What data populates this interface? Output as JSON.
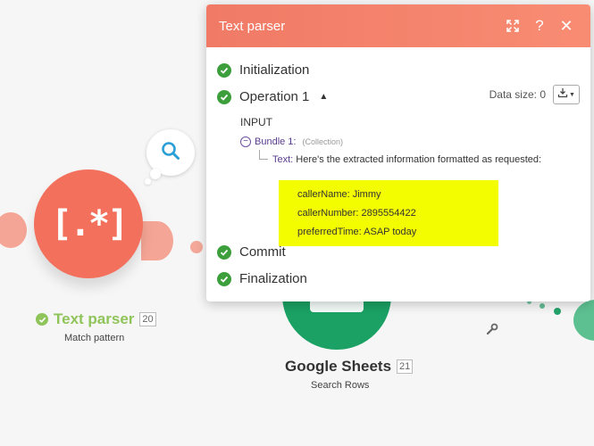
{
  "canvas": {
    "text_parser_module": {
      "name": "Text parser",
      "badge": "20",
      "subtitle": "Match pattern",
      "icon": "regex-icon",
      "status_icon": "check-circle-icon"
    },
    "google_sheets_module": {
      "name": "Google Sheets",
      "badge": "21",
      "subtitle": "Search Rows",
      "icon": "sheets-icon"
    },
    "search_bubble_icon": "magnifier-icon",
    "wrench_icon": "wrench-icon"
  },
  "panel": {
    "title": "Text parser",
    "header_buttons": [
      "expand-icon",
      "help-icon",
      "close-icon"
    ],
    "steps": {
      "initialization": "Initialization",
      "operation": "Operation 1",
      "commit": "Commit",
      "finalization": "Finalization"
    },
    "data_size": "Data size: 0",
    "input_label": "INPUT",
    "bundle": {
      "label": "Bundle 1:",
      "type": "(Collection)",
      "text_key": "Text:",
      "text_value": "Here's the extracted information formatted as requested:",
      "highlight_lines": [
        "callerName: Jimmy",
        "callerNumber: 2895554422",
        "preferredTime: ASAP today"
      ]
    }
  },
  "colors": {
    "header": "#f47e69",
    "check": "#3c9f3c",
    "highlight": "#f3fd00",
    "text_parser": "#f3705c",
    "google_sheets": "#1aa163",
    "success_text": "#8fc45a"
  }
}
